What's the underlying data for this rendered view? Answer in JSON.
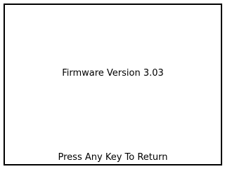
{
  "screen": {
    "firmware_version_text": "Firmware Version 3.03",
    "return_prompt": "Press Any Key To Return"
  },
  "colors": {
    "background": "#ffffff",
    "foreground": "#000000",
    "border": "#000000"
  }
}
